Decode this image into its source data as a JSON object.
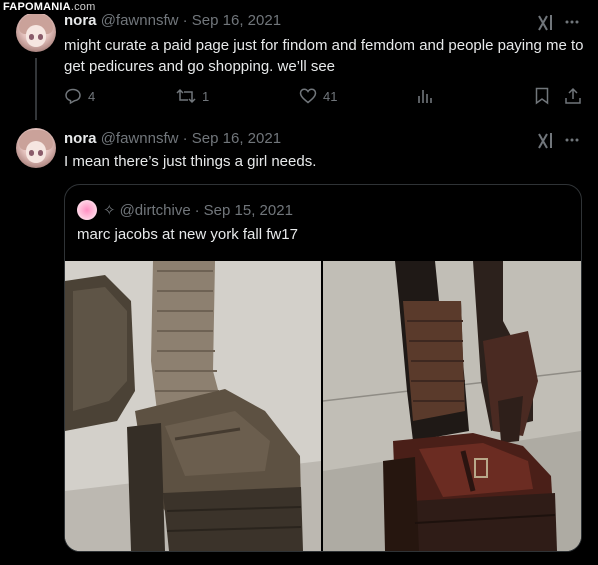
{
  "watermark": {
    "brand": "FAPOMANIA",
    "domain": ".com"
  },
  "tweets": [
    {
      "name": "nora",
      "handle": "@fawnnsfw",
      "separator": "·",
      "date": "Sep 16, 2021",
      "text": "might curate a paid page just for findom and femdom and people paying me to get pedicures and go shopping. we’ll see",
      "replies": "4",
      "retweets": "1",
      "likes": "41"
    },
    {
      "name": "nora",
      "handle": "@fawnnsfw",
      "separator": "·",
      "date": "Sep 16, 2021",
      "text": "I mean there’s just things a girl needs."
    }
  ],
  "quote": {
    "mark": "✧",
    "handle": "@dirtchive",
    "separator": "·",
    "date": "Sep 15, 2021",
    "text": "marc jacobs at new york fall fw17"
  },
  "icons": [
    "grok-icon",
    "more-icon",
    "reply-icon",
    "retweet-icon",
    "like-icon",
    "views-icon",
    "bookmark-icon",
    "share-icon"
  ],
  "colors": {
    "background": "#000000",
    "text": "#e7e9ea",
    "muted": "#71767b",
    "border": "#2f3336"
  }
}
